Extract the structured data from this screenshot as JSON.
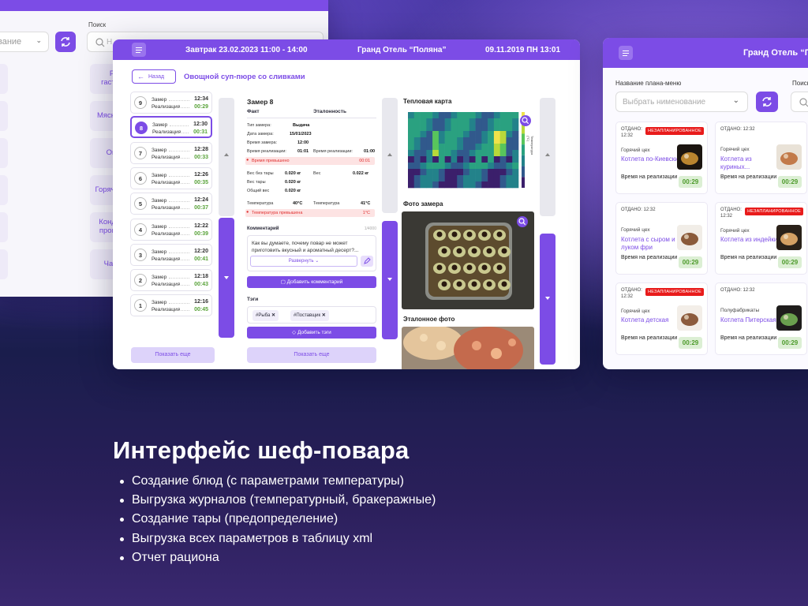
{
  "left_panel": {
    "search_label": "Поиск",
    "select_value": "вание",
    "categories": [
      "Рыбная гастрономия",
      "Мясные блюда",
      "Овощные",
      "Горячие закуски",
      "Кондитерское производство",
      "Чай / Кофе"
    ]
  },
  "center_panel": {
    "header": {
      "meal": "Завтрак 23.02.2023 11:00 - 14:00",
      "hotel": "Гранд Отель “Поляна”",
      "datetime": "09.11.2019 ПН 13:01"
    },
    "back_label": "Назад",
    "page_title": "Овощной суп-пюре со сливками",
    "measurements": [
      {
        "num": "9",
        "label": "Замер",
        "sub": "Реализация",
        "time": "12:34",
        "left": "00:29"
      },
      {
        "num": "8",
        "label": "Замер",
        "sub": "Реализация",
        "time": "12:30",
        "left": "00:31",
        "active": true
      },
      {
        "num": "7",
        "label": "Замер",
        "sub": "Реализация",
        "time": "12:28",
        "left": "00:33"
      },
      {
        "num": "6",
        "label": "Замер",
        "sub": "Реализация",
        "time": "12:26",
        "left": "00:35"
      },
      {
        "num": "5",
        "label": "Замер",
        "sub": "Реализация",
        "time": "12:24",
        "left": "00:37"
      },
      {
        "num": "4",
        "label": "Замер",
        "sub": "Реализация",
        "time": "12:22",
        "left": "00:39"
      },
      {
        "num": "3",
        "label": "Замер",
        "sub": "Реализация",
        "time": "12:20",
        "left": "00:41"
      },
      {
        "num": "2",
        "label": "Замер",
        "sub": "Реализация",
        "time": "12:18",
        "left": "00:43"
      },
      {
        "num": "1",
        "label": "Замер",
        "sub": "Реализация",
        "time": "12:16",
        "left": "00:45"
      }
    ],
    "show_more": "Показать еще",
    "detail": {
      "title": "Замер 8",
      "col_fact": "Факт",
      "col_ref": "Эталонность",
      "rows": [
        {
          "label": "Тип замера:",
          "value": "Выдача"
        },
        {
          "label": "Дата замера:",
          "value": "15/01/2023"
        },
        {
          "label": "Время замера:",
          "value": "12:00"
        },
        {
          "label": "Время реализации:",
          "value": "01:01",
          "ref_label": "Время реализации:",
          "ref_value": "01:00"
        }
      ],
      "time_error": "Время превышено",
      "time_error_value": "00:01",
      "weights": [
        {
          "label": "Вес без тары",
          "value": "0.020 кг",
          "ref_label": "Вес",
          "ref_value": "0.022 кг"
        },
        {
          "label": "Вес тары",
          "value": "0.020 кг"
        },
        {
          "label": "Общий вес",
          "value": "0.020 кг"
        }
      ],
      "temp_label": "Температура",
      "temp_value": "40°C",
      "temp_ref_label": "Температура",
      "temp_ref_value": "41°C",
      "temp_error": "Температура превышена",
      "temp_error_value": "1°C",
      "comment_label": "Комментарий",
      "comment_meta": "1/4000",
      "comment_text": "Как вы думаете, почему повар не может приготовить вкусный и ароматный десерт?...",
      "expand_label": "Развернуть",
      "add_comment": "Добавить комментарий",
      "tags_label": "Тэги",
      "tags": [
        "#Рыба",
        "#Поставщик"
      ],
      "add_tags": "Добавить тэги",
      "show_more": "Показать еще"
    },
    "heatmap_title": "Тепловая карта",
    "heatmap_axis": "Температура (°C)",
    "photo_title": "Фото замера",
    "ref_photo_title": "Эталонное фото"
  },
  "right_panel": {
    "hotel": "Гранд Отель “П",
    "plan_label": "Название плана-меню",
    "search_label": "Поиск",
    "select_placeholder": "Выбрать нименование",
    "cards": [
      {
        "sent": "ОТДАНО:",
        "sent_time": "12:32",
        "badge": "НЕЗАПЛАНИРОВАННОЕ",
        "shop": "Горячий цех",
        "name": "Котлета по-Киевски",
        "rt": "Время на реализации",
        "time": "00:29"
      },
      {
        "sent": "ОТДАНО: 12:32",
        "sent_time": "",
        "badge": "",
        "shop": "Горячий цех",
        "name": "Котлета из куриных...",
        "rt": "Время на реализации",
        "time": "00:29"
      },
      {
        "sent": "ОТДАНО: 12:32",
        "sent_time": "",
        "badge": "",
        "shop": "Горячий цех",
        "name": "Котлета с сыром и луком фри",
        "rt": "Время на реализации",
        "time": "00:29"
      },
      {
        "sent": "ОТДАНО:",
        "sent_time": "12:32",
        "badge": "НЕЗАПЛАНИРОВАННОЕ",
        "shop": "Горячий цех",
        "name": "Котлета из индейки",
        "rt": "Время на реализации",
        "time": "00:29"
      },
      {
        "sent": "ОТДАНО:",
        "sent_time": "12:32",
        "badge": "НЕЗАПЛАНИРОВАННОЕ",
        "shop": "Горячий цех",
        "name": "Котлета детская",
        "rt": "Время на реализации",
        "time": "00:29"
      },
      {
        "sent": "ОТДАНО: 12:32",
        "sent_time": "",
        "badge": "",
        "shop": "Полуфабрикаты",
        "name": "Котлета Питерская",
        "rt": "Время на реализации",
        "time": "00:29"
      }
    ]
  },
  "caption": {
    "title": "Интерфейс шеф-повара",
    "bullets": [
      "Создание блюд (с параметрами температуры)",
      "Выгрузка журналов (температурный, бракеражные)",
      "Создание тары (предопределение)",
      "Выгрузка всех параметров в таблицу xml",
      "Отчет рациона"
    ]
  },
  "colors": {
    "accent": "#7c4ce6",
    "success": "#59a33a",
    "danger": "#e81b1b"
  }
}
